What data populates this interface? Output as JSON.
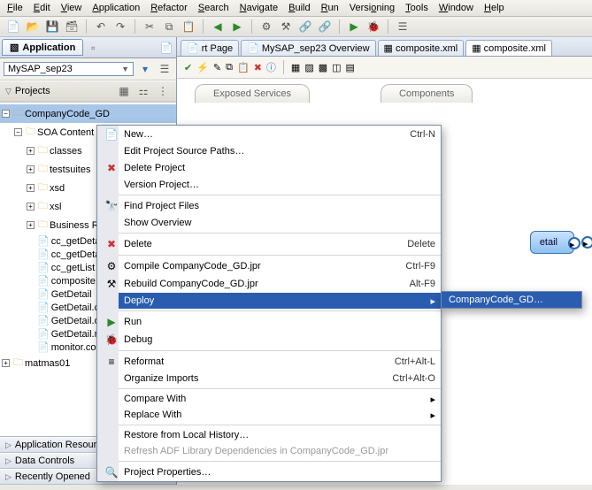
{
  "menu": {
    "file": "File",
    "edit": "Edit",
    "view": "View",
    "application": "Application",
    "refactor": "Refactor",
    "search": "Search",
    "navigate": "Navigate",
    "build": "Build",
    "run": "Run",
    "versioning": "Versioning",
    "tools": "Tools",
    "window": "Window",
    "help": "Help"
  },
  "apptab": "Application",
  "project_combo": "MySAP_sep23",
  "projects_header": "Projects",
  "tree": {
    "root": "CompanyCode_GD",
    "soa": "SOA Content",
    "nodes": [
      "classes",
      "testsuites",
      "xsd",
      "xsl",
      "Business Rules"
    ],
    "files": [
      "cc_getDetail",
      "cc_getDetail",
      "cc_getList",
      "composite.xml",
      "GetDetail",
      "GetDetail.componentT",
      "GetDetail.decs",
      "GetDetail.rules",
      "monitor.config"
    ],
    "matmas": "matmas01"
  },
  "accordion": {
    "ar": "Application Resources",
    "dc": "Data Controls",
    "ro": "Recently Opened"
  },
  "editor_tabs": {
    "t1": "rt Page",
    "t2": "MySAP_sep23 Overview",
    "t3": "composite.xml",
    "t4": "composite.xml"
  },
  "section_tabs": {
    "es": "Exposed Services",
    "comp": "Components"
  },
  "flow_node": "etail",
  "ctx": {
    "new": "New…",
    "sc_new": "Ctrl-N",
    "editpsp": "Edit Project Source Paths…",
    "delproj": "Delete Project",
    "verproj": "Version Project…",
    "findpf": "Find Project Files",
    "showov": "Show Overview",
    "delete": "Delete",
    "sc_delete": "Delete",
    "compile": "Compile CompanyCode_GD.jpr",
    "sc_compile": "Ctrl-F9",
    "rebuild": "Rebuild CompanyCode_GD.jpr",
    "sc_rebuild": "Alt-F9",
    "deploy": "Deploy",
    "run": "Run",
    "debug": "Debug",
    "reformat": "Reformat",
    "sc_reformat": "Ctrl+Alt-L",
    "orgimp": "Organize Imports",
    "sc_orgimp": "Ctrl+Alt-O",
    "cmpwith": "Compare With",
    "repwith": "Replace With",
    "restore": "Restore from Local History…",
    "refadf": "Refresh ADF Library Dependencies in CompanyCode_GD.jpr",
    "projprops": "Project Properties…"
  },
  "submenu": {
    "item": "CompanyCode_GD…"
  }
}
